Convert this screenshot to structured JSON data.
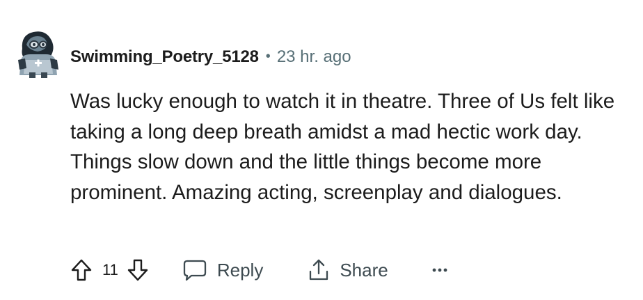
{
  "comment": {
    "author": "Swimming_Poetry_5128",
    "separator": "•",
    "timestamp": "23 hr. ago",
    "body": "Was lucky enough to watch it in theatre. Three of Us felt like taking a long deep breath amidst a mad hectic work day. Things slow down and the little things become more prominent. Amazing acting, screenplay and dialogues."
  },
  "actions": {
    "upvote_icon": "arrow-up-icon",
    "score": "11",
    "downvote_icon": "arrow-down-icon",
    "reply_icon": "speech-bubble-icon",
    "reply_label": "Reply",
    "share_icon": "share-upload-icon",
    "share_label": "Share",
    "more_label": "•••"
  },
  "colors": {
    "text": "#1c1c1c",
    "meta": "#576f76",
    "action_text": "#3d4a50",
    "background": "#ffffff"
  }
}
